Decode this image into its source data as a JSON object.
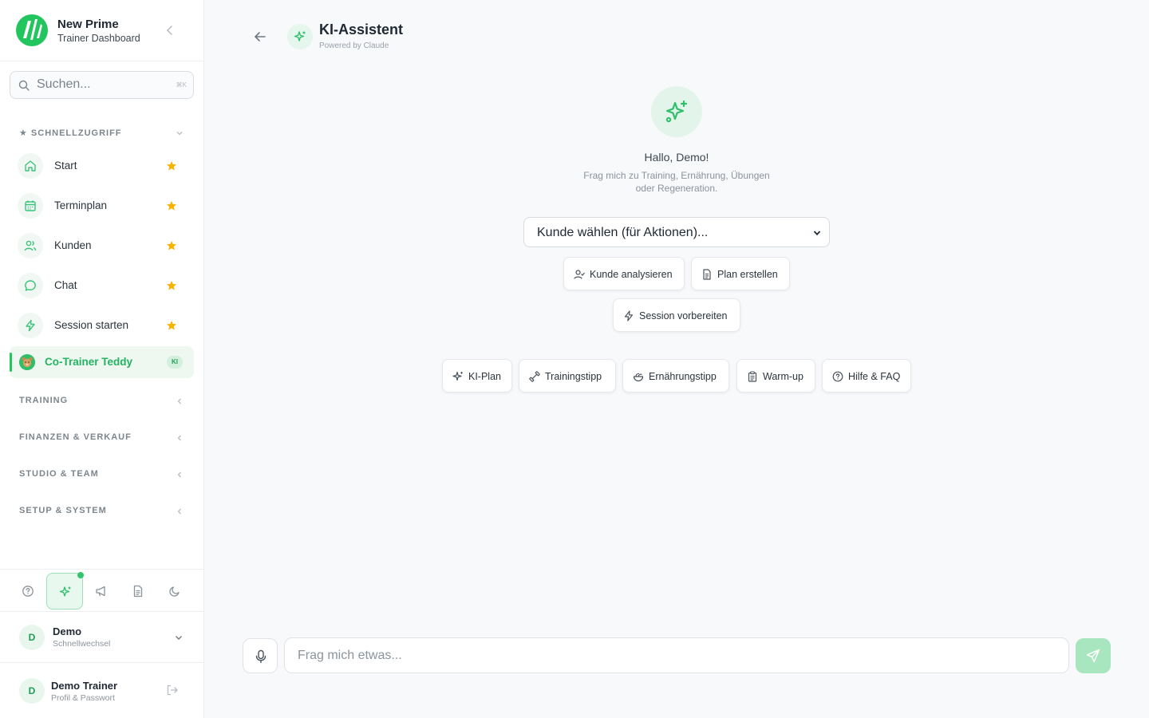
{
  "brand": {
    "title": "New Prime",
    "subtitle": "Trainer Dashboard"
  },
  "search": {
    "placeholder": "Suchen...",
    "shortcut": "⌘K"
  },
  "sidebar": {
    "quick_access": {
      "heading": "★ SCHNELLZUGRIFF",
      "items": [
        {
          "label": "Start",
          "icon": "home-icon",
          "favorite": true
        },
        {
          "label": "Terminplan",
          "icon": "calendar-icon",
          "favorite": true
        },
        {
          "label": "Kunden",
          "icon": "users-icon",
          "favorite": true
        },
        {
          "label": "Chat",
          "icon": "chat-bubble-icon",
          "favorite": true
        },
        {
          "label": "Session starten",
          "icon": "lightning-icon",
          "favorite": true
        }
      ]
    },
    "active_item": {
      "label": "Co-Trainer Teddy",
      "badge": "KI",
      "icon": "teddy-bear-icon"
    },
    "sections": [
      "TRAINING",
      "FINANZEN & VERKAUF",
      "STUDIO & TEAM",
      "SETUP & SYSTEM"
    ]
  },
  "toolbar": {
    "buttons": [
      "help-icon",
      "ai-sparkles-icon",
      "megaphone-icon",
      "document-icon",
      "moon-icon"
    ],
    "active": "ai-sparkles-icon"
  },
  "account_switcher": {
    "initial": "D",
    "name": "Demo",
    "subtitle": "Schnellwechsel"
  },
  "user": {
    "initial": "D",
    "name": "Demo Trainer",
    "subtitle": "Profil & Passwort"
  },
  "header": {
    "title": "KI-Assistent",
    "subtitle": "Powered by Claude"
  },
  "welcome": {
    "greeting": "Hallo, Demo!",
    "line1": "Frag mich zu Training, Ernährung, Übungen",
    "line2": "oder Regeneration."
  },
  "client_select": {
    "value": "Kunde wählen (für Aktionen)..."
  },
  "actions": [
    "Kunde analysieren",
    "Plan erstellen",
    "Session vorbereiten"
  ],
  "quick_prompts": [
    "KI-Plan",
    "Trainingstipp",
    "Ernährungstipp",
    "Warm-up",
    "Hilfe & FAQ"
  ],
  "composer": {
    "placeholder": "Frag mich etwas..."
  },
  "colors": {
    "accent": "#22c55e",
    "star": "#f5b400",
    "background": "#f8f9fb"
  }
}
